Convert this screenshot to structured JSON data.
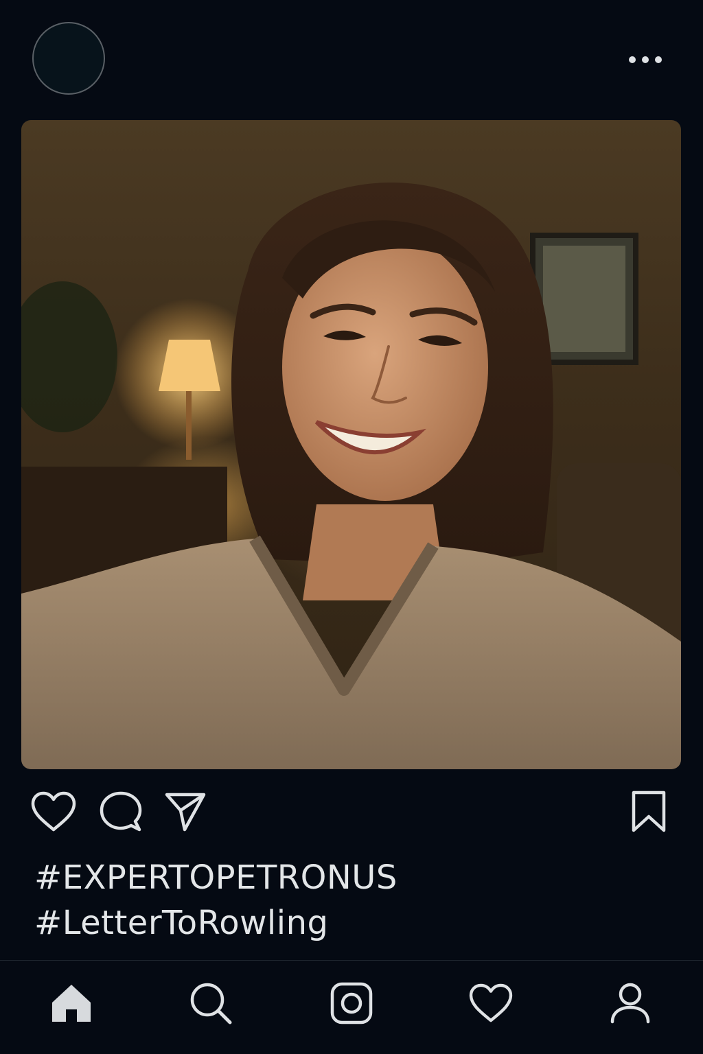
{
  "post": {
    "caption": {
      "tag_1": "#EXPERTOPETRONUS",
      "tag_2": "#LetterToRowling"
    },
    "photo_alt": "Smiling woman in a beige knit sweater taking a selfie in a warmly lit living room"
  },
  "icons": {
    "header": [
      "avatar",
      "more-icon"
    ],
    "actions": [
      "heart-icon",
      "comment-icon",
      "share-icon",
      "bookmark-icon"
    ],
    "bottom_nav": [
      "home-icon",
      "search-icon",
      "camera-icon",
      "heart-icon",
      "profile-icon"
    ]
  },
  "colors": {
    "background": "#050a13",
    "icon": "#dfe2e5",
    "text": "#e3e6e8",
    "photo_warm": "#4b3a23"
  }
}
